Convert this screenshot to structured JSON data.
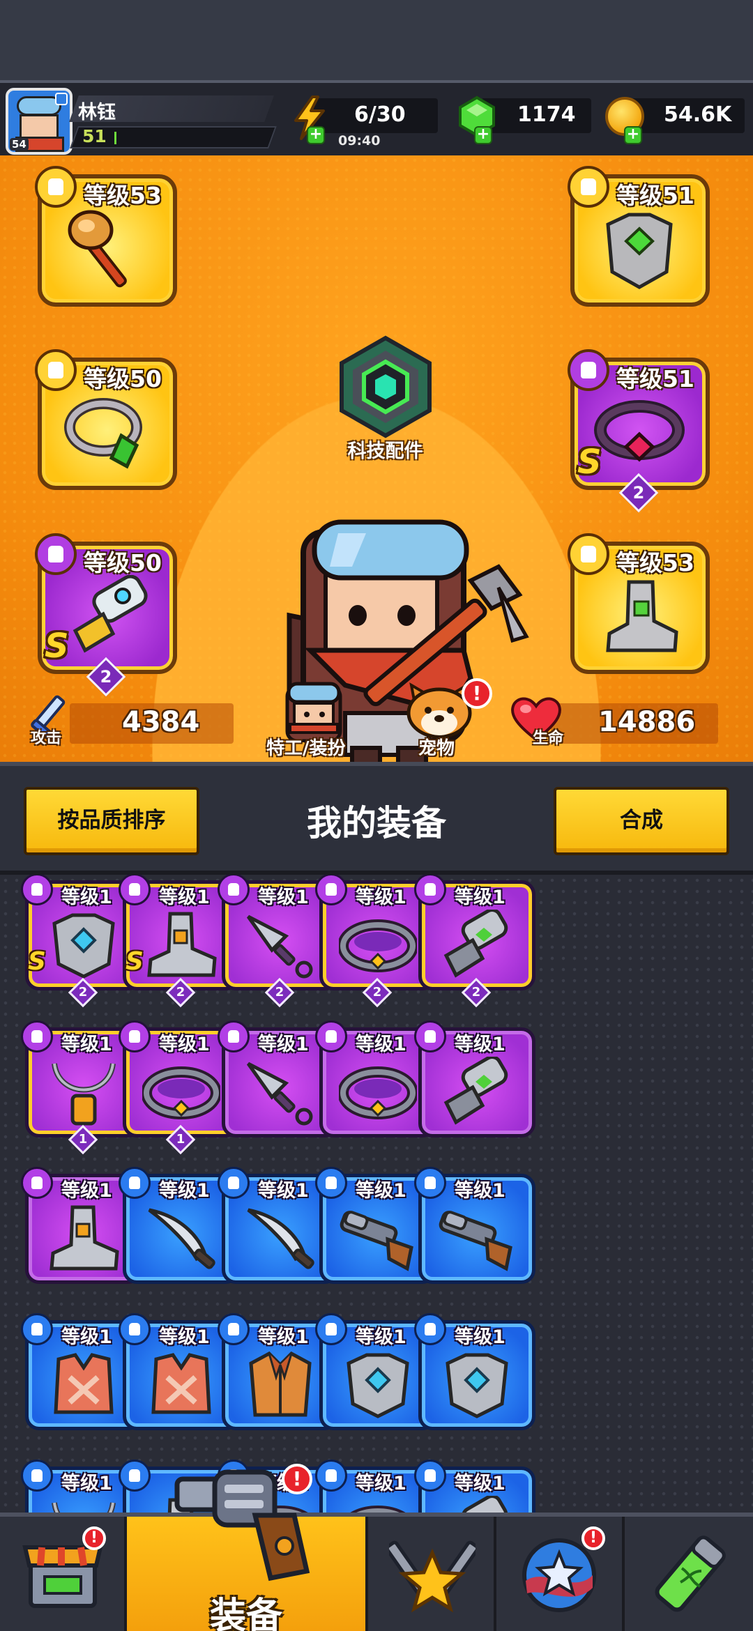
{
  "header": {
    "player_name": "林钰",
    "player_level": "51",
    "avatar_level": "54",
    "energy": "6/30",
    "energy_timer": "09:40",
    "gems": "1174",
    "gold": "54.6K"
  },
  "equipped": {
    "tech_parts_label": "科技配件",
    "left": [
      {
        "slot": "weapon",
        "level": "等级53",
        "rarity": "gold",
        "item": "hammer-icon"
      },
      {
        "slot": "ring",
        "level": "等级50",
        "rarity": "gold",
        "item": "ring-icon"
      },
      {
        "slot": "gloves",
        "level": "等级50",
        "rarity": "purple",
        "item": "gauntlet-icon",
        "grade": "S",
        "rank": "2"
      }
    ],
    "right": [
      {
        "slot": "armor",
        "level": "等级51",
        "rarity": "gold",
        "item": "armor-icon"
      },
      {
        "slot": "belt",
        "level": "等级51",
        "rarity": "purple",
        "item": "belt-icon",
        "grade": "S",
        "rank": "2"
      },
      {
        "slot": "boots",
        "level": "等级53",
        "rarity": "gold",
        "item": "boots-icon"
      }
    ]
  },
  "stats": {
    "attack_label": "攻击",
    "attack_value": "4384",
    "hp_label": "生命",
    "hp_value": "14886",
    "agent_label": "特工/装扮",
    "pet_label": "宠物",
    "pet_alert": "!"
  },
  "inventory": {
    "sort_button": "按品质排序",
    "title": "我的装备",
    "merge_button": "合成",
    "rows": [
      [
        {
          "level": "等级1",
          "rarity": "purple",
          "trim": true,
          "item": "armor-icon",
          "grade": "S",
          "rank": "2"
        },
        {
          "level": "等级1",
          "rarity": "purple",
          "trim": true,
          "item": "boots-icon",
          "grade": "S",
          "rank": "2"
        },
        {
          "level": "等级1",
          "rarity": "purple",
          "trim": true,
          "item": "kunai-icon",
          "rank": "2"
        },
        {
          "level": "等级1",
          "rarity": "purple",
          "trim": true,
          "item": "belt-icon",
          "rank": "2"
        },
        {
          "level": "等级1",
          "rarity": "purple",
          "trim": true,
          "item": "gauntlet-icon",
          "rank": "2"
        }
      ],
      [
        {
          "level": "等级1",
          "rarity": "purple",
          "trim": true,
          "item": "necklace-icon",
          "rank": "1"
        },
        {
          "level": "等级1",
          "rarity": "purple",
          "trim": true,
          "item": "belt-icon",
          "rank": "1"
        },
        {
          "level": "等级1",
          "rarity": "purple",
          "item": "kunai-icon"
        },
        {
          "level": "等级1",
          "rarity": "purple",
          "item": "belt-icon"
        },
        {
          "level": "等级1",
          "rarity": "purple",
          "item": "gauntlet-icon"
        }
      ],
      [
        {
          "level": "等级1",
          "rarity": "purple",
          "item": "boots-icon"
        },
        {
          "level": "等级1",
          "rarity": "blue",
          "item": "machete-icon"
        },
        {
          "level": "等级1",
          "rarity": "blue",
          "item": "machete-icon"
        },
        {
          "level": "等级1",
          "rarity": "blue",
          "item": "shotgun-icon"
        },
        {
          "level": "等级1",
          "rarity": "blue",
          "item": "shotgun-icon"
        }
      ],
      [
        {
          "level": "等级1",
          "rarity": "blue",
          "item": "vest-icon"
        },
        {
          "level": "等级1",
          "rarity": "blue",
          "item": "vest-icon"
        },
        {
          "level": "等级1",
          "rarity": "blue",
          "item": "jacket-icon"
        },
        {
          "level": "等级1",
          "rarity": "blue",
          "item": "armor-icon"
        },
        {
          "level": "等级1",
          "rarity": "blue",
          "item": "armor-icon"
        }
      ],
      [
        {
          "level": "等级1",
          "rarity": "blue",
          "item": "necklace-icon"
        },
        {
          "level": "",
          "rarity": "blue",
          "item": "boots-icon"
        },
        {
          "level": "等级1",
          "rarity": "blue",
          "item": "belt-icon"
        },
        {
          "level": "等级1",
          "rarity": "blue",
          "item": "belt-icon"
        },
        {
          "level": "等级1",
          "rarity": "blue",
          "item": "gauntlet-icon"
        }
      ]
    ]
  },
  "nav": {
    "items": [
      {
        "name": "shop",
        "icon": "shop-icon",
        "alert": "!"
      },
      {
        "name": "equipment",
        "icon": "revolver-icon",
        "label": "装备",
        "alert": "!",
        "active": true
      },
      {
        "name": "battle",
        "icon": "crossed-swords-icon"
      },
      {
        "name": "talents",
        "icon": "star-orb-icon",
        "alert": "!"
      },
      {
        "name": "evolution",
        "icon": "dna-capsule-icon"
      }
    ]
  },
  "colors": {
    "gold_frame": "#ffc413",
    "purple_frame": "#a02fd4",
    "blue_frame": "#1c63e6",
    "panel_orange": "#f58c0e",
    "button_yellow": "#ffd936",
    "alert_red": "#e8232b"
  }
}
